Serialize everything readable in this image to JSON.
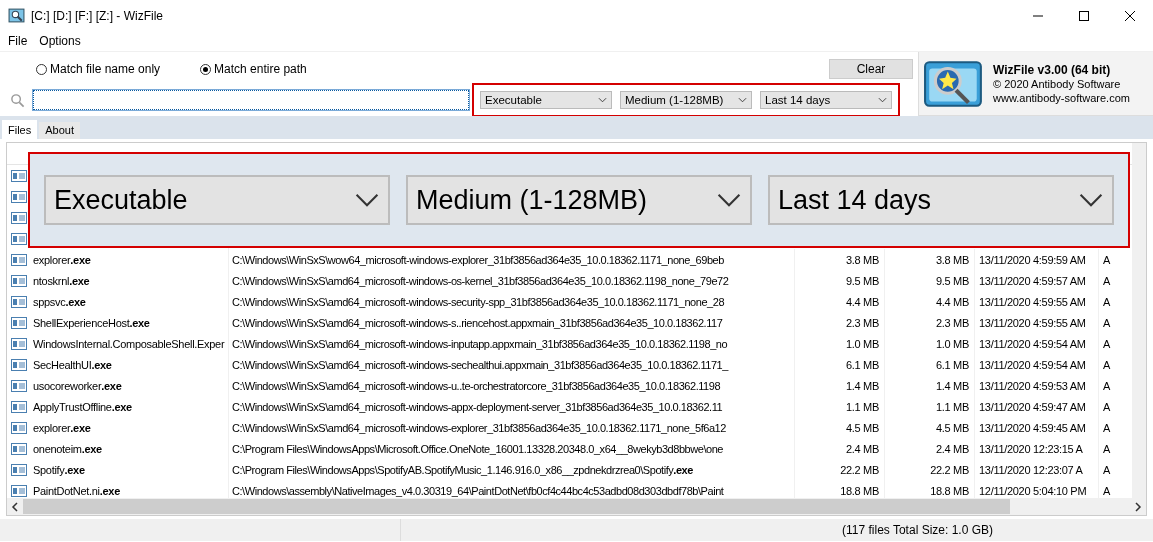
{
  "window": {
    "title": "[C:] [D:] [F:] [Z:]  - WizFile"
  },
  "menu": [
    "File",
    "Options"
  ],
  "match_options": [
    {
      "label": "Match file name only",
      "selected": false
    },
    {
      "label": "Match entire path",
      "selected": true
    }
  ],
  "search": {
    "focused": true
  },
  "filters": [
    "Executable",
    "Medium (1-128MB)",
    "Last 14 days"
  ],
  "clear_button": "Clear",
  "about": {
    "title": "WizFile v3.00 (64 bit)",
    "copyright": "© 2020 Antibody Software",
    "website": "www.antibody-software.com"
  },
  "tabs": [
    {
      "label": "Files",
      "selected": true
    },
    {
      "label": "About",
      "selected": false
    }
  ],
  "callout": {
    "filters": [
      "Executable",
      "Medium (1-128MB)",
      "Last 14 days"
    ]
  },
  "table": {
    "rows": [
      {
        "name": "explorer**.exe**",
        "path": "C:\\Windows\\WinSxS\\wow64_microsoft-windows-explorer_31bf3856ad364e35_10.0.18362.1171_none_69beb",
        "size": "3.8 MB",
        "allocated": "3.8 MB",
        "modified": "13/11/2020 4:59:59 AM",
        "attr": "A"
      },
      {
        "name": "ntoskrnl**.exe**",
        "path": "C:\\Windows\\WinSxS\\amd64_microsoft-windows-os-kernel_31bf3856ad364e35_10.0.18362.1198_none_79e72",
        "size": "9.5 MB",
        "allocated": "9.5 MB",
        "modified": "13/11/2020 4:59:57 AM",
        "attr": "A"
      },
      {
        "name": "sppsvc**.exe**",
        "path": "C:\\Windows\\WinSxS\\amd64_microsoft-windows-security-spp_31bf3856ad364e35_10.0.18362.1171_none_28",
        "size": "4.4 MB",
        "allocated": "4.4 MB",
        "modified": "13/11/2020 4:59:55 AM",
        "attr": "A"
      },
      {
        "name": "ShellExperienceHost**.exe**",
        "path": "C:\\Windows\\WinSxS\\amd64_microsoft-windows-s..riencehost.appxmain_31bf3856ad364e35_10.0.18362.117",
        "size": "2.3 MB",
        "allocated": "2.3 MB",
        "modified": "13/11/2020 4:59:55 AM",
        "attr": "A"
      },
      {
        "name": "WindowsInternal.ComposableShell.Exper",
        "path": "C:\\Windows\\WinSxS\\amd64_microsoft-windows-inputapp.appxmain_31bf3856ad364e35_10.0.18362.1198_no",
        "size": "1.0 MB",
        "allocated": "1.0 MB",
        "modified": "13/11/2020 4:59:54 AM",
        "attr": "A"
      },
      {
        "name": "SecHealthUI**.exe**",
        "path": "C:\\Windows\\WinSxS\\amd64_microsoft-windows-sechealthui.appxmain_31bf3856ad364e35_10.0.18362.1171_",
        "size": "6.1 MB",
        "allocated": "6.1 MB",
        "modified": "13/11/2020 4:59:54 AM",
        "attr": "A"
      },
      {
        "name": "usocoreworker**.exe**",
        "path": "C:\\Windows\\WinSxS\\amd64_microsoft-windows-u..te-orchestratorcore_31bf3856ad364e35_10.0.18362.1198",
        "size": "1.4 MB",
        "allocated": "1.4 MB",
        "modified": "13/11/2020 4:59:53 AM",
        "attr": "A"
      },
      {
        "name": "ApplyTrustOffline**.exe**",
        "path": "C:\\Windows\\WinSxS\\amd64_microsoft-windows-appx-deployment-server_31bf3856ad364e35_10.0.18362.11",
        "size": "1.1 MB",
        "allocated": "1.1 MB",
        "modified": "13/11/2020 4:59:47 AM",
        "attr": "A"
      },
      {
        "name": "explorer**.exe**",
        "path": "C:\\Windows\\WinSxS\\amd64_microsoft-windows-explorer_31bf3856ad364e35_10.0.18362.1171_none_5f6a12",
        "size": "4.5 MB",
        "allocated": "4.5 MB",
        "modified": "13/11/2020 4:59:45 AM",
        "attr": "A"
      },
      {
        "name": "onenoteim**.exe**",
        "path": "C:\\Program Files\\WindowsApps\\Microsoft.Office.OneNote_16001.13328.20348.0_x64__8wekyb3d8bbwe\\one",
        "size": "2.4 MB",
        "allocated": "2.4 MB",
        "modified": "13/11/2020 12:23:15 A",
        "attr": "A"
      },
      {
        "name": "Spotify**.exe**",
        "path": "C:\\Program Files\\WindowsApps\\SpotifyAB.SpotifyMusic_1.146.916.0_x86__zpdnekdrzrea0\\Spotify**.exe**",
        "size": "22.2 MB",
        "allocated": "22.2 MB",
        "modified": "13/11/2020 12:23:07 A",
        "attr": "A"
      },
      {
        "name": "PaintDotNet.ni**.exe**",
        "path": "C:\\Windows\\assembly\\NativeImages_v4.0.30319_64\\PaintDotNet\\fb0cf4c44bc4c53adbd08d303dbdf78b\\Paint",
        "size": "18.8 MB",
        "allocated": "18.8 MB",
        "modified": "12/11/2020 5:04:10 PM",
        "attr": "A"
      }
    ]
  },
  "status_bar": "(117 files  Total Size: 1.0 GB)"
}
